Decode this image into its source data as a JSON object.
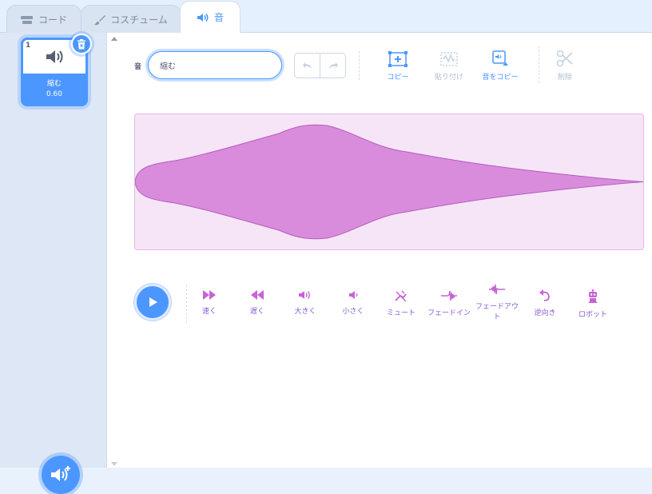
{
  "tabs": [
    {
      "label": "コード",
      "icon": "code-icon"
    },
    {
      "label": "コスチューム",
      "icon": "brush-icon"
    },
    {
      "label": "音",
      "icon": "speaker-icon",
      "active": true
    }
  ],
  "sound_list": {
    "items": [
      {
        "index": "1",
        "name": "縮む",
        "duration": "0.60"
      }
    ]
  },
  "editor": {
    "sound_label": "音",
    "sound_name": "縮む",
    "toolbar": {
      "copy": "コピー",
      "paste": "貼り付け",
      "copy_to_new": "音をコピー",
      "delete": "削除"
    },
    "effects": [
      {
        "label": "速く",
        "icon": "faster-icon"
      },
      {
        "label": "遅く",
        "icon": "slower-icon"
      },
      {
        "label": "大きく",
        "icon": "louder-icon"
      },
      {
        "label": "小さく",
        "icon": "softer-icon"
      },
      {
        "label": "ミュート",
        "icon": "mute-icon"
      },
      {
        "label": "フェードイン",
        "icon": "fade-in-icon"
      },
      {
        "label": "フェードアウト",
        "icon": "fade-out-icon"
      },
      {
        "label": "逆向き",
        "icon": "reverse-icon"
      },
      {
        "label": "ロボット",
        "icon": "robot-icon"
      }
    ]
  },
  "colors": {
    "accent": "#4c97ff",
    "sound_wave": "#d98cdb",
    "effect": "#855cd6"
  }
}
